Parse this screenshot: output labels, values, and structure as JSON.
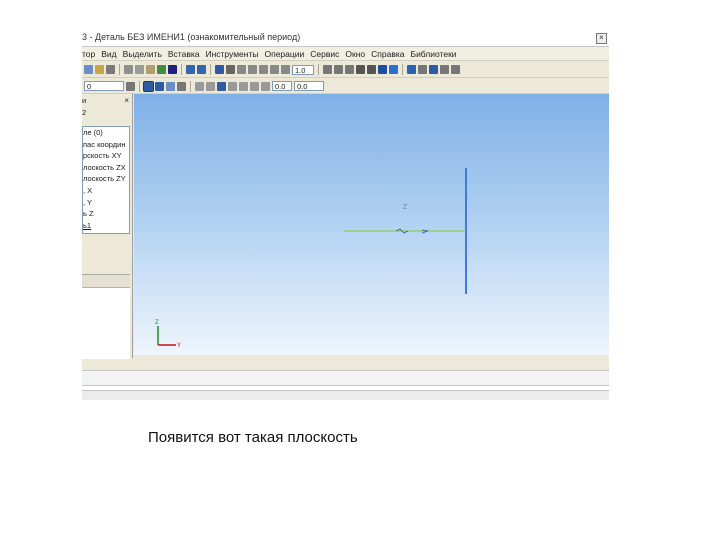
{
  "window": {
    "title": "3 - Деталь БЕЗ ИМЕНИ1 (ознакомительный период)",
    "close_glyph": "×"
  },
  "menu": [
    "тор",
    "Вид",
    "Выделить",
    "Вставка",
    "Инструменты",
    "Операции",
    "Сервис",
    "Окно",
    "Справка",
    "Библиотеки"
  ],
  "toolbar": {
    "scale_value": "1.0",
    "left_field": "0",
    "coord_x": "0.0",
    "coord_y": "0.0"
  },
  "panel": {
    "title": "и",
    "close_glyph": "×",
    "tab": "2",
    "tree_items": [
      "ле (0)",
      "пас координ",
      "рскость XY",
      "лоскость ZX",
      "лоскость ZY",
      ", X",
      ", Y",
      "ь Z",
      "ь1"
    ]
  },
  "viewport": {
    "axis_z": "Z",
    "axis_y": "Y"
  },
  "caption": "Появится вот такая плоскость",
  "colors": {
    "plane_line": "#3a7fd6",
    "axis_line": "#88cc33",
    "triad_red": "#cc1111",
    "triad_green": "#119911"
  }
}
